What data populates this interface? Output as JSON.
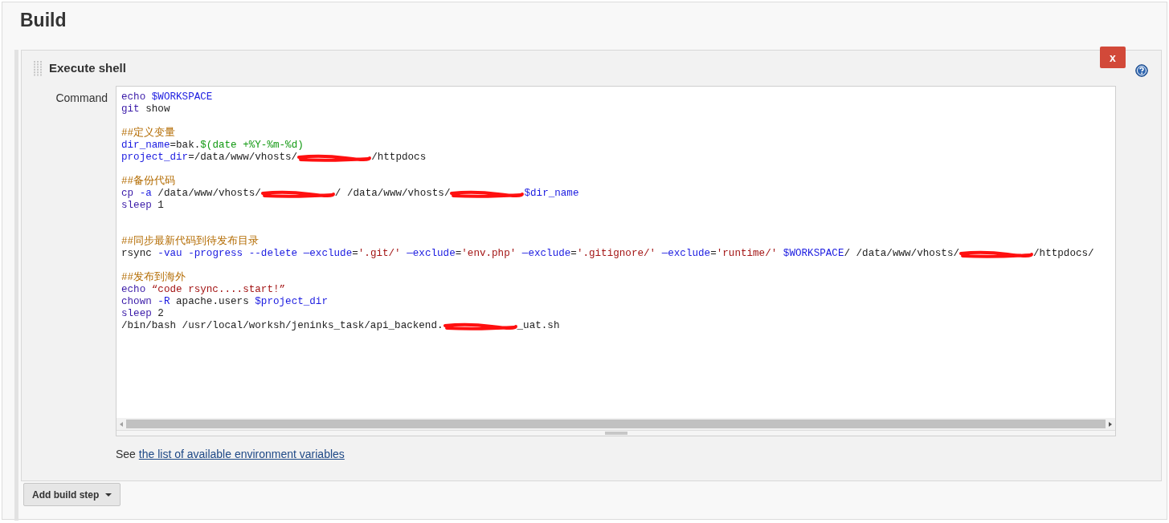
{
  "section": {
    "title": "Build"
  },
  "step": {
    "title": "Execute shell",
    "delete_button": "x",
    "field_label": "Command",
    "lines": [
      {
        "kind": "code",
        "tokens": [
          {
            "kind": "keyword",
            "text": "echo "
          },
          {
            "kind": "variable",
            "text": "$WORKSPACE"
          }
        ]
      },
      {
        "kind": "code",
        "tokens": [
          {
            "kind": "keyword",
            "text": "git"
          },
          {
            "kind": "plain",
            "text": " show"
          }
        ]
      },
      {
        "kind": "blank"
      },
      {
        "kind": "code",
        "tokens": [
          {
            "kind": "comment",
            "text": "##定义变量"
          }
        ]
      },
      {
        "kind": "code",
        "tokens": [
          {
            "kind": "variable",
            "text": "dir_name"
          },
          {
            "kind": "plain",
            "text": "=bak."
          },
          {
            "kind": "subshell",
            "text": "$(date +%Y-%m-%d)"
          }
        ]
      },
      {
        "kind": "code",
        "tokens": [
          {
            "kind": "variable",
            "text": "project_dir"
          },
          {
            "kind": "plain",
            "text": "=/data/www/vhosts/"
          },
          {
            "kind": "redacted"
          },
          {
            "kind": "plain",
            "text": "/httpdocs"
          }
        ]
      },
      {
        "kind": "blank"
      },
      {
        "kind": "code",
        "tokens": [
          {
            "kind": "comment",
            "text": "##备份代码"
          }
        ]
      },
      {
        "kind": "code",
        "tokens": [
          {
            "kind": "keyword",
            "text": "cp"
          },
          {
            "kind": "variable",
            "text": " -a"
          },
          {
            "kind": "plain",
            "text": " /data/www/vhosts/"
          },
          {
            "kind": "redacted"
          },
          {
            "kind": "plain",
            "text": "/ /data/www/vhosts/"
          },
          {
            "kind": "redacted"
          },
          {
            "kind": "variable",
            "text": "$dir_name"
          }
        ]
      },
      {
        "kind": "code",
        "tokens": [
          {
            "kind": "keyword",
            "text": "sleep"
          },
          {
            "kind": "plain",
            "text": " 1"
          }
        ]
      },
      {
        "kind": "blank"
      },
      {
        "kind": "blank"
      },
      {
        "kind": "code",
        "tokens": [
          {
            "kind": "comment",
            "text": "##同步最新代码到待发布目录"
          }
        ]
      },
      {
        "kind": "code",
        "tokens": [
          {
            "kind": "plain",
            "text": "rsync "
          },
          {
            "kind": "variable",
            "text": "-vau -progress --delete —exclude"
          },
          {
            "kind": "plain",
            "text": "="
          },
          {
            "kind": "string",
            "text": "'.git/' "
          },
          {
            "kind": "variable",
            "text": "—exclude"
          },
          {
            "kind": "plain",
            "text": "="
          },
          {
            "kind": "string",
            "text": "'env.php' "
          },
          {
            "kind": "variable",
            "text": "—exclude"
          },
          {
            "kind": "plain",
            "text": "="
          },
          {
            "kind": "string",
            "text": "'.gitignore/' "
          },
          {
            "kind": "variable",
            "text": "—exclude"
          },
          {
            "kind": "plain",
            "text": "="
          },
          {
            "kind": "string",
            "text": "'runtime/' "
          },
          {
            "kind": "variable",
            "text": "$WORKSPACE"
          },
          {
            "kind": "plain",
            "text": "/ /data/www/vhosts/"
          },
          {
            "kind": "redacted"
          },
          {
            "kind": "plain",
            "text": "/httpdocs/"
          }
        ]
      },
      {
        "kind": "blank"
      },
      {
        "kind": "code",
        "tokens": [
          {
            "kind": "comment",
            "text": "##发布到海外"
          }
        ]
      },
      {
        "kind": "code",
        "tokens": [
          {
            "kind": "keyword",
            "text": "echo "
          },
          {
            "kind": "string",
            "text": "“code rsync....start!”"
          }
        ]
      },
      {
        "kind": "code",
        "tokens": [
          {
            "kind": "keyword",
            "text": "chown"
          },
          {
            "kind": "variable",
            "text": " -R"
          },
          {
            "kind": "plain",
            "text": " apache.users "
          },
          {
            "kind": "variable",
            "text": "$project_dir"
          }
        ]
      },
      {
        "kind": "code",
        "tokens": [
          {
            "kind": "keyword",
            "text": "sleep"
          },
          {
            "kind": "plain",
            "text": " 2"
          }
        ]
      },
      {
        "kind": "code",
        "tokens": [
          {
            "kind": "plain",
            "text": "/bin/bash /usr/local/worksh/jeninks_task/api_backend."
          },
          {
            "kind": "redacted"
          },
          {
            "kind": "plain",
            "text": "_uat.sh"
          }
        ]
      }
    ],
    "hint": "See",
    "hint_link": "the list of available environment variables"
  },
  "add_button": "Add build step"
}
